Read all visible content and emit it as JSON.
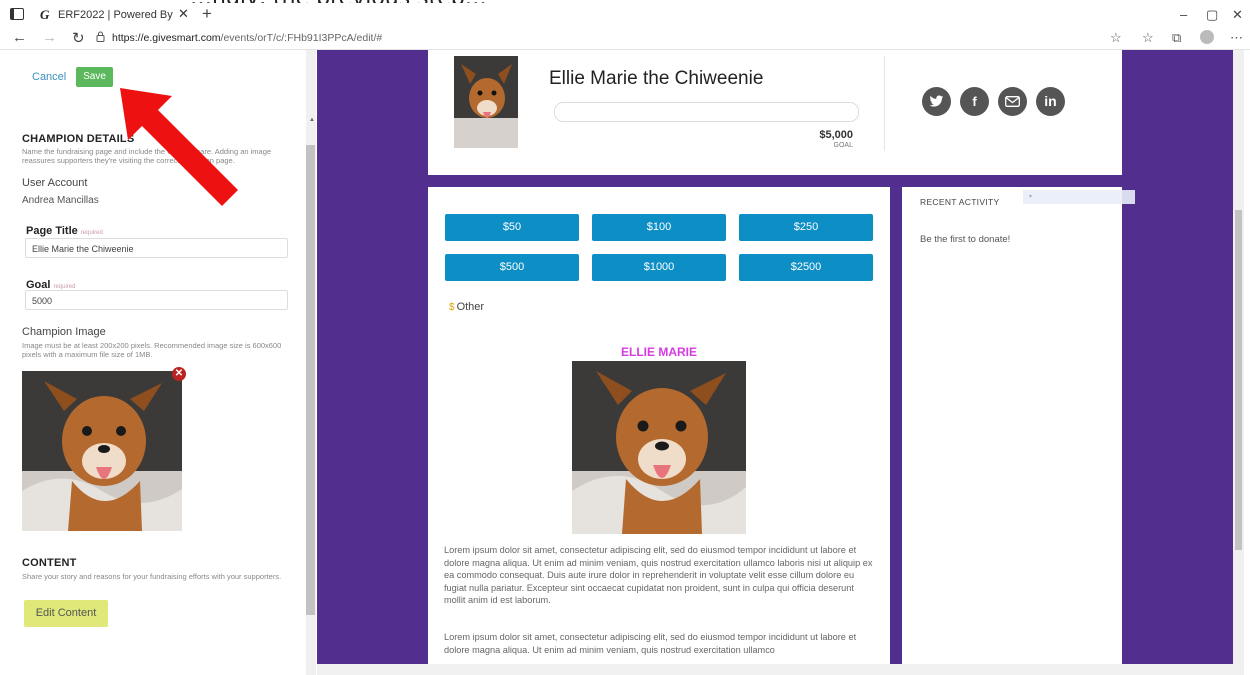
{
  "browser": {
    "tab_title": "ERF2022 | Powered By",
    "tab_favicon": "G",
    "url_domain": "https://e.givesmart.com",
    "url_path": "/events/orT/c/:FHb91I3PPcA/edit/#"
  },
  "editor": {
    "cancel_label": "Cancel",
    "save_label": "Save",
    "section_champion": "CHAMPION DETAILS",
    "champion_help": "Name the fundraising page and include the URL to share. Adding an image reassures supporters they're visiting the correct champion page.",
    "user_account_label": "User Account",
    "user_account_value": "Andrea Mancillas",
    "page_title_label": "Page Title",
    "page_title_required": "required",
    "page_title_value": "Ellie Marie the Chiweenie",
    "goal_label": "Goal",
    "goal_required": "required",
    "goal_value": "5000",
    "champion_image_label": "Champion Image",
    "champion_image_help": "Image must be at least 200x200 pixels. Recommended image size is 600x600 pixels with a maximum file size of 1MB.",
    "section_content": "CONTENT",
    "content_help": "Share your story and reasons for your fundraising efforts with your supporters.",
    "edit_content_label": "Edit Content"
  },
  "preview": {
    "champion_name": "Ellie Marie the Chiweenie",
    "goal_amount": "$5,000",
    "goal_label": "GOAL",
    "donation_amounts": [
      "$50",
      "$100",
      "$250",
      "$500",
      "$1000",
      "$2500"
    ],
    "other_symbol": "$",
    "other_label": "Other",
    "story_title": "ELLIE MARIE",
    "lorem_1": "Lorem ipsum dolor sit amet, consectetur adipiscing elit, sed do eiusmod tempor incididunt ut labore et dolore magna aliqua. Ut enim ad minim veniam, quis nostrud exercitation ullamco laboris nisi ut aliquip ex ea commodo consequat. Duis aute irure dolor in reprehenderit in voluptate velit esse cillum dolore eu fugiat nulla pariatur. Excepteur sint occaecat cupidatat non proident, sunt in culpa qui officia deserunt mollit anim id est laborum.",
    "lorem_2": "Lorem ipsum dolor sit amet, consectetur adipiscing elit, sed do eiusmod tempor incididunt ut labore et dolore magna aliqua. Ut enim ad minim veniam, quis nostrud exercitation ullamco",
    "recent_activity_label": "RECENT ACTIVITY",
    "recent_activity_empty": "Be the first to donate!",
    "social_icons": [
      "twitter-icon",
      "facebook-icon",
      "email-icon",
      "linkedin-icon"
    ]
  },
  "colors": {
    "brand_purple": "#522f8f",
    "donate_blue": "#0d8ec5",
    "save_green": "#5cb85c",
    "edit_yellow": "#dfe878",
    "highlight_pink": "#d63be0",
    "arrow_red": "#ee1111"
  }
}
